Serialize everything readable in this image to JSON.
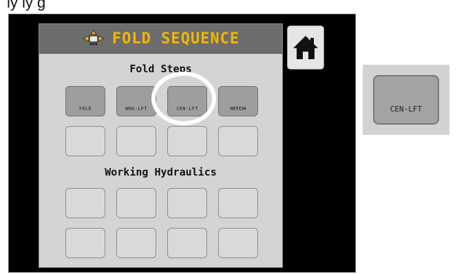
{
  "caption": "ly          ly                    g",
  "header": {
    "title": "FOLD SEQUENCE",
    "icon": "fold-machine-icon",
    "title_color": "#f2b700"
  },
  "fold_steps": {
    "title": "Fold Steps",
    "buttons": [
      {
        "label": "FOLD",
        "filled": true
      },
      {
        "label": "WNG-LFT",
        "filled": true
      },
      {
        "label": "CEN-LFT",
        "filled": true,
        "highlighted": true
      },
      {
        "label": "HITCH",
        "filled": true
      },
      {
        "label": "",
        "filled": false
      },
      {
        "label": "",
        "filled": false
      },
      {
        "label": "",
        "filled": false
      },
      {
        "label": "",
        "filled": false
      }
    ]
  },
  "working_hydraulics": {
    "title": "Working Hydraulics",
    "buttons": [
      "",
      "",
      "",
      "",
      "",
      "",
      "",
      ""
    ]
  },
  "home_button": {
    "icon": "home-icon"
  },
  "inset": {
    "label": "CEN-LFT"
  }
}
